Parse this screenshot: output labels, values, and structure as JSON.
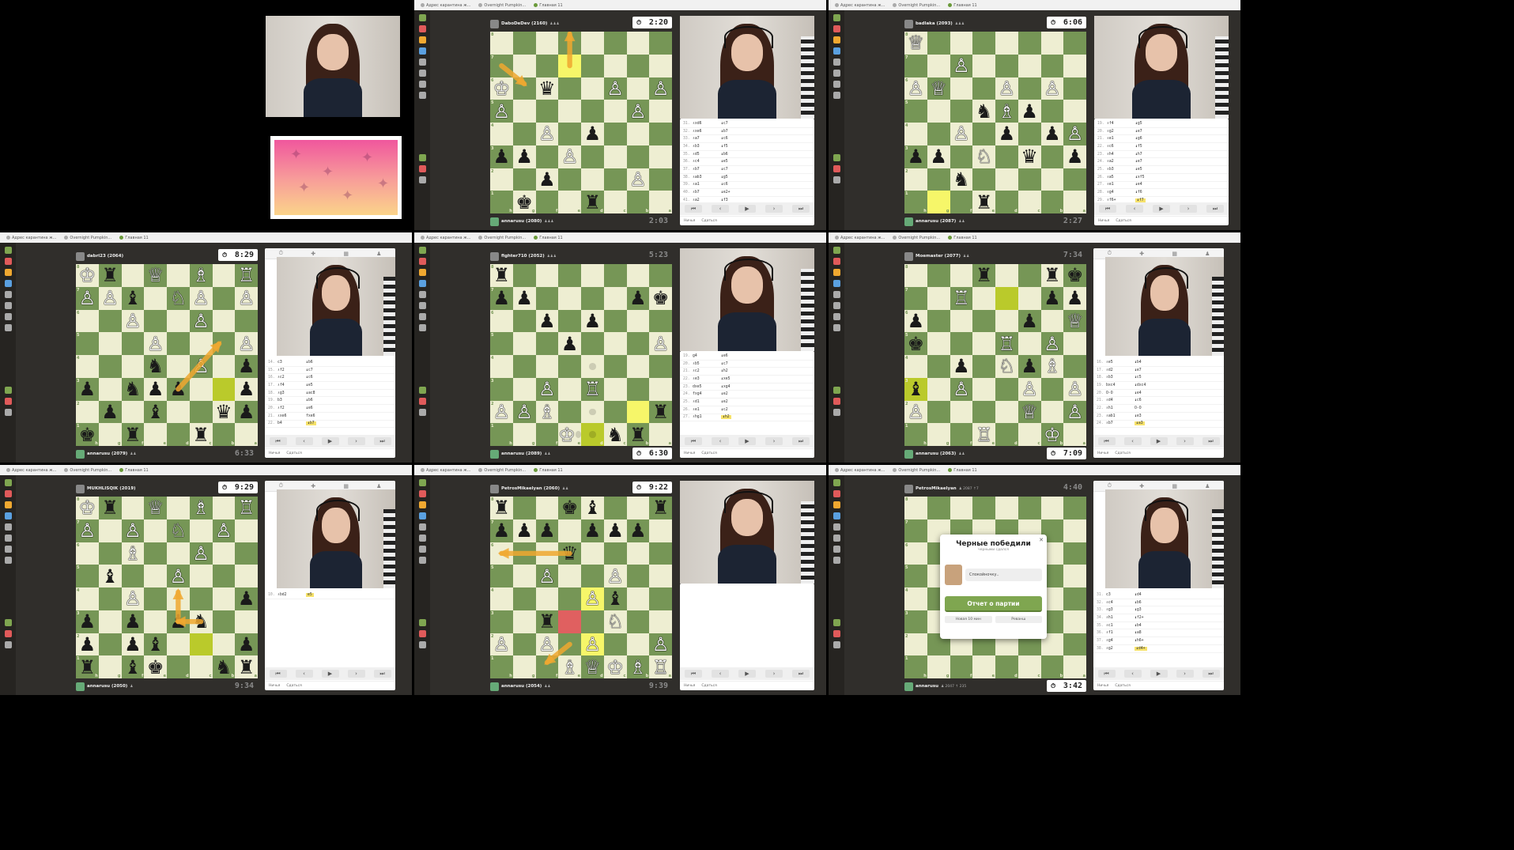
{
  "tabs": [
    "Адрес карантина ж...",
    "Overnight Pumpkin...",
    "Главная 11"
  ],
  "panel_footer": {
    "new": "Ничья",
    "resign": "Сдаться"
  },
  "nav_glyphs": {
    "first": "⏮",
    "prev": "‹",
    "next": "›",
    "last": "⏭",
    "play": "▶"
  },
  "intro": {
    "label": ""
  },
  "games": [
    {
      "id": "g1",
      "opponent": "DaboDeDev (2160)",
      "opp_sub": "♟♟♟",
      "me": "annarusu (2080)",
      "me_sub": "♟♟♟",
      "top_clock": "2:20",
      "bottom_clock": "2:03",
      "top_active": true,
      "bottom_active": false,
      "moves": [
        [
          "31.",
          "♗xd6",
          "♝c7"
        ],
        [
          "32.",
          "♗xe6",
          "♝b7"
        ],
        [
          "33.",
          "♗a7",
          "♝c6"
        ],
        [
          "34.",
          "♗b3",
          "♝f5"
        ],
        [
          "35.",
          "♗d5",
          "♝b6"
        ],
        [
          "36.",
          "♗c4",
          "♝e5"
        ],
        [
          "37.",
          "♗b7",
          "♝c7"
        ],
        [
          "38.",
          "♗ab3",
          "♝g5"
        ],
        [
          "39.",
          "♗a1",
          "♝c6"
        ],
        [
          "40.",
          "♗b7",
          "♝e2+"
        ],
        [
          "41.",
          "♗a2",
          "♝f3"
        ],
        [
          "42.",
          "♗b7",
          "♝xf3"
        ]
      ]
    },
    {
      "id": "g2",
      "opponent": "badlaka (2093)",
      "opp_sub": "♟♟♟",
      "me": "annarusu (2087)",
      "me_sub": "♟♟",
      "top_clock": "6:06",
      "bottom_clock": "2:27",
      "top_active": true,
      "bottom_active": false,
      "moves": [
        [
          "19.",
          "♗f4",
          "♝g5"
        ],
        [
          "20.",
          "♗g2",
          "♝e7"
        ],
        [
          "21.",
          "♗e1",
          "♝g6"
        ],
        [
          "22.",
          "♗c6",
          "♝f5"
        ],
        [
          "23.",
          "♗h4",
          "♝h7"
        ],
        [
          "24.",
          "♗a2",
          "♝e7"
        ],
        [
          "25.",
          "♗b3",
          "♝e5"
        ],
        [
          "26.",
          "♗a5",
          "♝xf5"
        ],
        [
          "27.",
          "♗e1",
          "♝e4"
        ],
        [
          "28.",
          "♗g4",
          "♝f6"
        ],
        [
          "29.",
          "♗f6+",
          "♝f7"
        ]
      ]
    },
    {
      "id": "g3",
      "opponent": "dabri23 (2064)",
      "opp_sub": "",
      "me": "annarusu (2079)",
      "me_sub": "♟♟",
      "top_clock": "8:29",
      "bottom_clock": "6:33",
      "top_active": true,
      "bottom_active": false,
      "moves": [
        [
          "14.",
          "c3",
          "♝b6"
        ],
        [
          "15.",
          "♗f2",
          "♝c7"
        ],
        [
          "16.",
          "♗c2",
          "♝c6"
        ],
        [
          "17.",
          "♗f4",
          "♝e5"
        ],
        [
          "18.",
          "♗g3",
          "♝ac8"
        ],
        [
          "19.",
          "b3",
          "♝b6"
        ],
        [
          "20.",
          "♗f2",
          "♝e6"
        ],
        [
          "21.",
          "♗xe6",
          "fxe6"
        ],
        [
          "22.",
          "b4",
          "♝b7"
        ]
      ]
    },
    {
      "id": "g4",
      "opponent": "fighter710 (2052)",
      "opp_sub": "♟♟♟",
      "me": "annarusu (2089)",
      "me_sub": "♟♟",
      "top_clock": "5:23",
      "bottom_clock": "6:30",
      "top_active": false,
      "bottom_active": true,
      "moves": [
        [
          "19.",
          "g4",
          "♝e6"
        ],
        [
          "20.",
          "♗b5",
          "♝c7"
        ],
        [
          "21.",
          "♗c2",
          "♝h2"
        ],
        [
          "22.",
          "♗e3",
          "♝xe5"
        ],
        [
          "23.",
          "dxe5",
          "♝xg4"
        ],
        [
          "24.",
          "fxg4",
          "♝e2"
        ],
        [
          "25.",
          "♗d1",
          "♝e2"
        ],
        [
          "26.",
          "♗e1",
          "♝c2"
        ],
        [
          "27.",
          "♗hg1",
          "♝h2"
        ]
      ]
    },
    {
      "id": "g5",
      "opponent": "Moemaster (2077)",
      "opp_sub": "♟♟",
      "me": "annarusu (2063)",
      "me_sub": "♟♟",
      "top_clock": "7:34",
      "bottom_clock": "7:09",
      "top_active": false,
      "bottom_active": true,
      "moves": [
        [
          "16.",
          "♗e5",
          "♝b4"
        ],
        [
          "17.",
          "♗d2",
          "♝e7"
        ],
        [
          "18.",
          "♗b3",
          "♝c5"
        ],
        [
          "19.",
          "bxc4",
          "♝dxc4"
        ],
        [
          "20.",
          "O-O",
          "♝e4"
        ],
        [
          "21.",
          "♗d4",
          "♝c6"
        ],
        [
          "22.",
          "♗h1",
          "O-O"
        ],
        [
          "23.",
          "♗ab1",
          "♝e3"
        ],
        [
          "24.",
          "♗b7",
          "♝a3"
        ]
      ]
    },
    {
      "id": "g6",
      "opponent": "MUKHLISQIK (2019)",
      "opp_sub": "",
      "me": "annarusu (2050)",
      "me_sub": "♟",
      "top_clock": "9:29",
      "bottom_clock": "9:34",
      "top_active": true,
      "bottom_active": false,
      "moves": [
        [
          "10.",
          "♗bd2",
          "e5"
        ]
      ]
    },
    {
      "id": "g7",
      "opponent": "PetrosMikaelyan (2060)",
      "opp_sub": "♟♟",
      "me": "annarusu (2054)",
      "me_sub": "♟♟",
      "top_clock": "9:22",
      "bottom_clock": "9:39",
      "top_active": true,
      "bottom_active": false,
      "moves": []
    },
    {
      "id": "g8",
      "opponent": "PetrosMikaelyan",
      "opp_sub": "♟ 2087 ↑7",
      "me": "annarusu",
      "me_sub": "♟ 2047 ↑ 235",
      "top_clock": "4:40",
      "bottom_clock": "3:42",
      "top_active": false,
      "bottom_active": true,
      "moves": [
        [
          "31.",
          "c3",
          "♝d4"
        ],
        [
          "32.",
          "♗c4",
          "♝b6"
        ],
        [
          "33.",
          "♗g3",
          "♝g3"
        ],
        [
          "34.",
          "♗h1",
          "♝f2+"
        ],
        [
          "35.",
          "♗c1",
          "♝b4"
        ],
        [
          "36.",
          "♗f1",
          "♝a8"
        ],
        [
          "37.",
          "♗g4",
          "♝h6+"
        ],
        [
          "38.",
          "♗g2",
          "♝d4+"
        ]
      ],
      "modal": {
        "title": "Черные победили",
        "subtitle": "черными сдался",
        "chat": "Спокойночку..",
        "report": "Отчет о партии",
        "new_btn": "Новая 10 мин",
        "rematch": "Реванш"
      }
    }
  ],
  "colors": {
    "light": "#eeeed2",
    "dark": "#769656",
    "highlight": "#f6f669",
    "arrow": "#f0a830",
    "app_bg": "#302e2b"
  }
}
